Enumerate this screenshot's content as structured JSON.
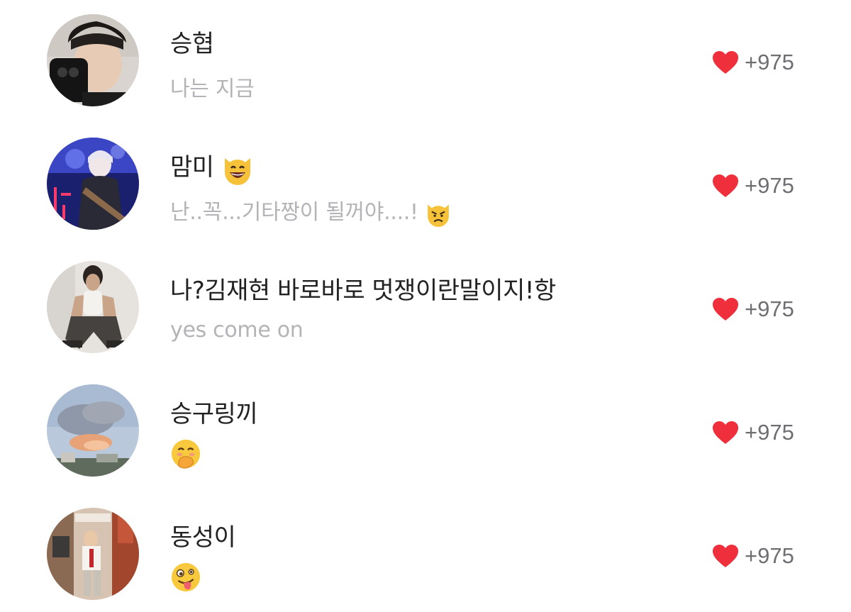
{
  "like_color": "#f02f3c",
  "comments": [
    {
      "name": "승협",
      "name_emoji": "",
      "text": "나는 지금",
      "text_emoji": "",
      "likes": "+975",
      "avatar": "selfie-with-phone"
    },
    {
      "name": "맘미",
      "name_emoji": "grinning-cat-icon",
      "text": "난..꼭...기타짱이 될꺼야....!",
      "text_emoji": "pouting-cat-icon",
      "likes": "+975",
      "avatar": "guitarist-on-stage"
    },
    {
      "name": "나?김재현 바로바로 멋쟁이란말이지!항",
      "name_emoji": "",
      "text": "yes come on",
      "text_emoji": "",
      "likes": "+975",
      "avatar": "man-sitting-by-wall"
    },
    {
      "name": "승구링끼",
      "name_emoji": "",
      "text": "",
      "text_emoji": "face-hand-over-mouth-icon",
      "likes": "+975",
      "avatar": "cloudy-sky"
    },
    {
      "name": "동성이",
      "name_emoji": "",
      "text": "",
      "text_emoji": "zany-face-icon",
      "likes": "+975",
      "avatar": "mirror-selfie-room"
    }
  ]
}
